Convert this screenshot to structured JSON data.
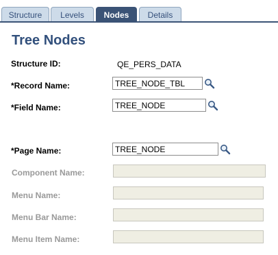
{
  "tabs": [
    {
      "label": "Structure",
      "active": false
    },
    {
      "label": "Levels",
      "active": false
    },
    {
      "label": "Nodes",
      "active": true
    },
    {
      "label": "Details",
      "active": false
    }
  ],
  "page_title": "Tree Nodes",
  "structure_id": {
    "label": "Structure ID:",
    "value": "QE_PERS_DATA"
  },
  "record_name": {
    "label": "*Record Name:",
    "value": "TREE_NODE_TBL"
  },
  "field_name": {
    "label": "*Field Name:",
    "value": "TREE_NODE"
  },
  "page_name": {
    "label": "*Page Name:",
    "value": "TREE_NODE"
  },
  "component_name": {
    "label": "Component Name:",
    "value": ""
  },
  "menu_name": {
    "label": "Menu Name:",
    "value": ""
  },
  "menu_bar_name": {
    "label": "Menu Bar Name:",
    "value": ""
  },
  "menu_item_name": {
    "label": "Menu Item Name:",
    "value": ""
  },
  "icons": {
    "lookup": "magnifier-lookup-icon"
  },
  "colors": {
    "active_tab": "#3b5376",
    "inactive_tab": "#cddbe9",
    "title": "#32507c",
    "disabled_field": "#efeee3"
  }
}
